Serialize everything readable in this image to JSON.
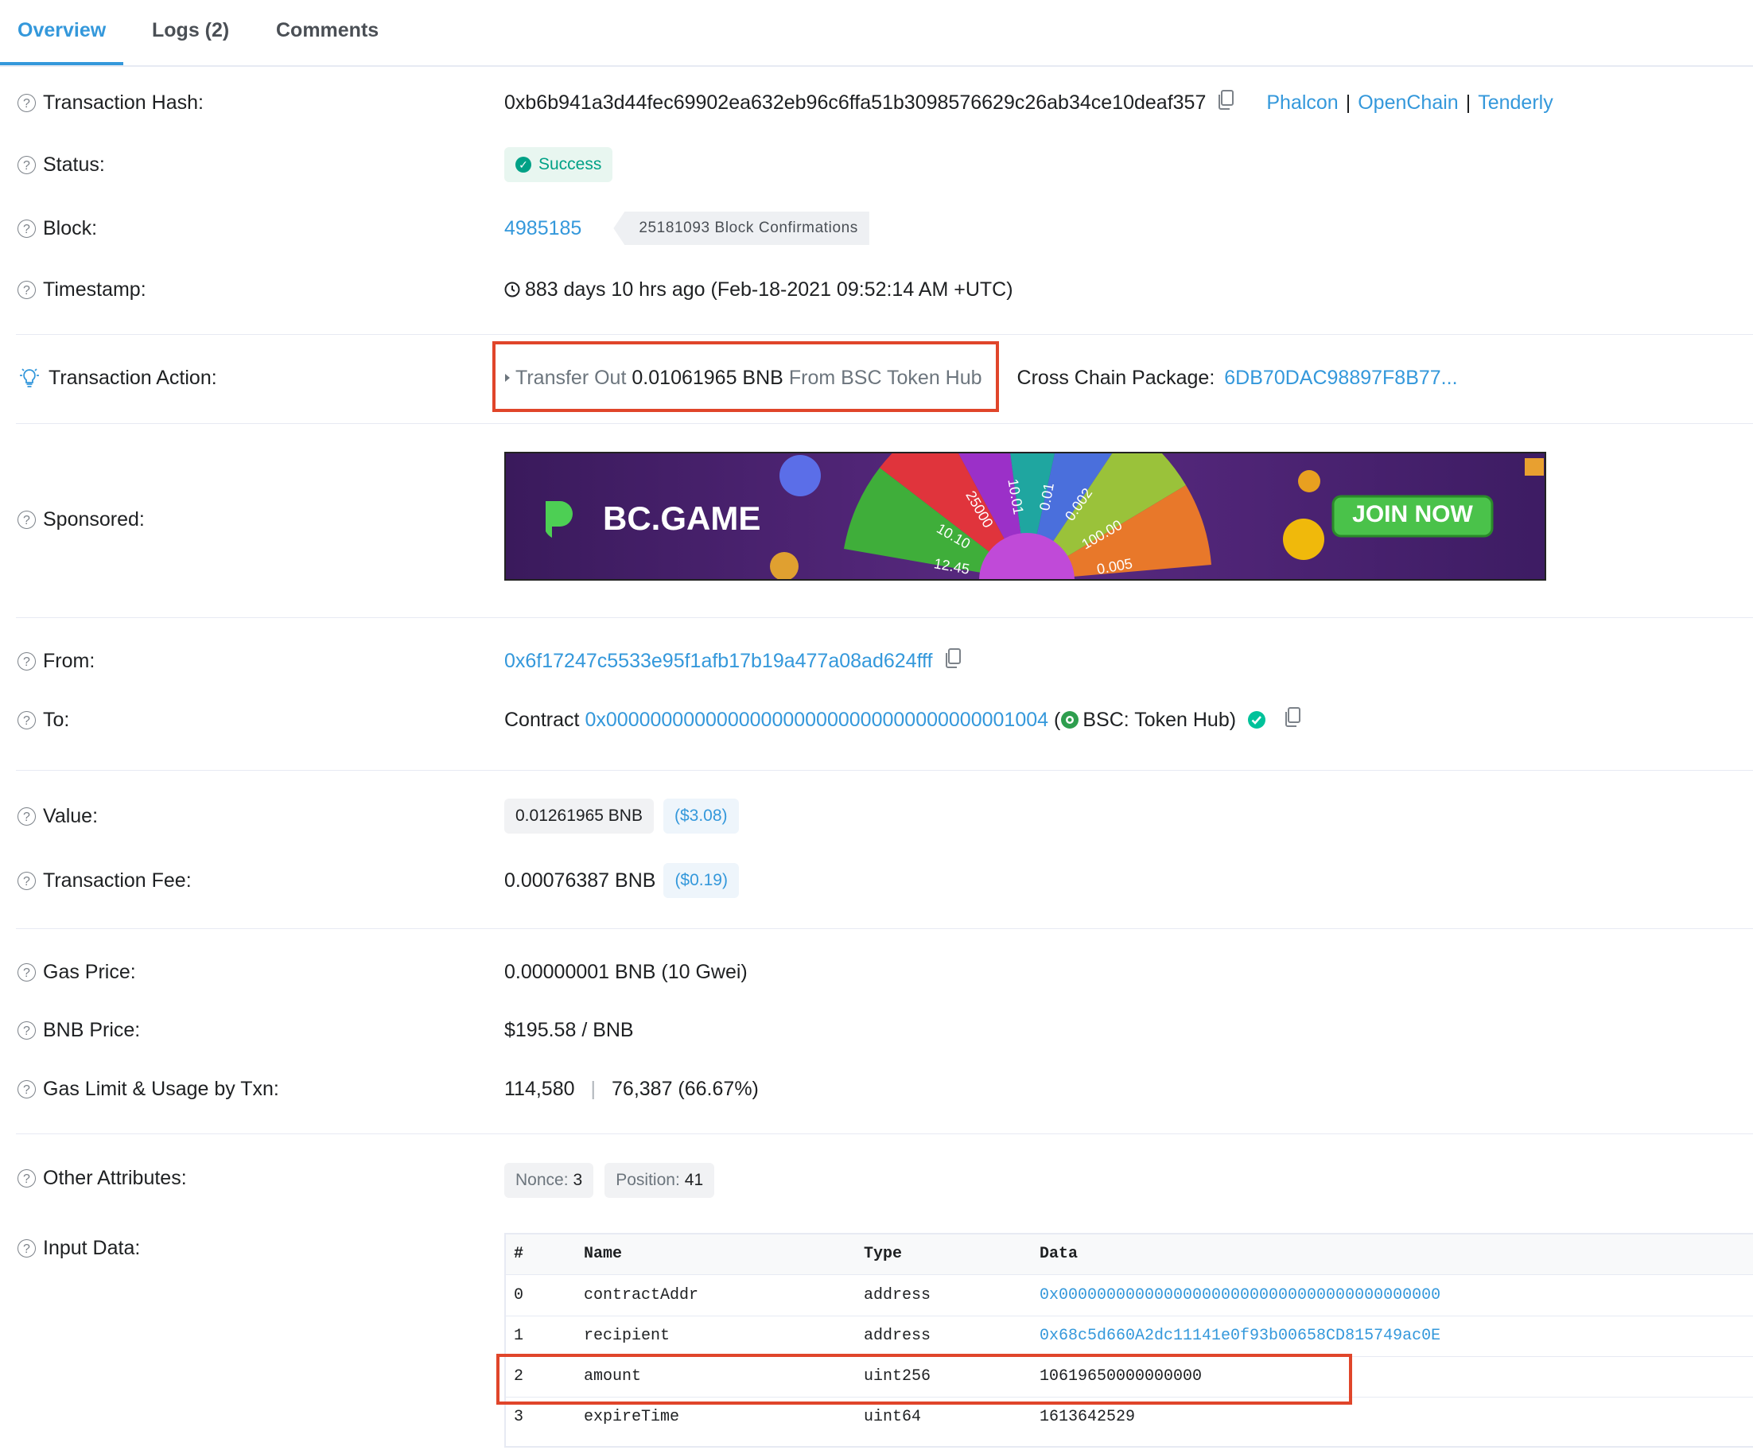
{
  "tabs": [
    {
      "label": "Overview"
    },
    {
      "label": "Logs (2)"
    },
    {
      "label": "Comments"
    }
  ],
  "hash": {
    "label": "Transaction Hash:",
    "value": "0xb6b941a3d44fec69902ea632eb96c6ffa51b3098576629c26ab34ce10deaf357",
    "links": [
      "Phalcon",
      "OpenChain",
      "Tenderly"
    ],
    "separator": "|"
  },
  "status": {
    "label": "Status:",
    "value": "Success"
  },
  "block": {
    "label": "Block:",
    "number": "4985185",
    "confirmations": "25181093 Block Confirmations"
  },
  "timestamp": {
    "label": "Timestamp:",
    "value": "883 days 10 hrs ago (Feb-18-2021 09:52:14 AM +UTC)"
  },
  "action": {
    "label": "Transaction Action:",
    "verb": "Transfer Out",
    "amount": "0.01061965 BNB",
    "from_text": "From BSC Token Hub",
    "package_label": "Cross Chain Package:",
    "package_value": "6DB70DAC98897F8B77..."
  },
  "sponsored": {
    "label": "Sponsored:",
    "brand": "BC.GAME",
    "cta": "JOIN NOW",
    "wheel_values": [
      "25000",
      "10.01",
      "0.01",
      "0.002",
      "100.00",
      "0.005",
      "12.45",
      "10.10"
    ]
  },
  "from": {
    "label": "From:",
    "address": "0x6f17247c5533e95f1afb17b19a477a08ad624fff"
  },
  "to": {
    "label": "To:",
    "prefix": "Contract",
    "address": "0x0000000000000000000000000000000000001004",
    "name": "BSC: Token Hub)",
    "open_paren": "("
  },
  "value": {
    "label": "Value:",
    "amount": "0.01261965 BNB",
    "usd": "($3.08)"
  },
  "fee": {
    "label": "Transaction Fee:",
    "amount": "0.00076387 BNB",
    "usd": "($0.19)"
  },
  "gas_price": {
    "label": "Gas Price:",
    "value": "0.00000001 BNB (10 Gwei)"
  },
  "bnb_price": {
    "label": "BNB Price:",
    "value": "$195.58 / BNB"
  },
  "gas_limit": {
    "label": "Gas Limit & Usage by Txn:",
    "limit": "114,580",
    "usage": "76,387 (66.67%)",
    "separator": "|"
  },
  "other": {
    "label": "Other Attributes:",
    "nonce_label": "Nonce:",
    "nonce": "3",
    "position_label": "Position:",
    "position": "41"
  },
  "input": {
    "label": "Input Data:",
    "headers": [
      "#",
      "Name",
      "Type",
      "Data"
    ],
    "rows": [
      {
        "idx": "0",
        "name": "contractAddr",
        "type": "address",
        "data": "0x0000000000000000000000000000000000000000"
      },
      {
        "idx": "1",
        "name": "recipient",
        "type": "address",
        "data": "0x68c5d660A2dc11141e0f93b00658CD815749ac0E"
      },
      {
        "idx": "2",
        "name": "amount",
        "type": "uint256",
        "data": "10619650000000000"
      },
      {
        "idx": "3",
        "name": "expireTime",
        "type": "uint64",
        "data": "1613642529"
      }
    ]
  },
  "colors": {
    "accent": "#3498db",
    "success": "#00a186",
    "highlight": "#e0452a"
  },
  "icons": [
    "question-icon",
    "lightbulb-icon",
    "copy-icon",
    "check-circle-icon",
    "clock-icon",
    "caret-right-icon",
    "verified-icon",
    "token-logo-icon"
  ]
}
